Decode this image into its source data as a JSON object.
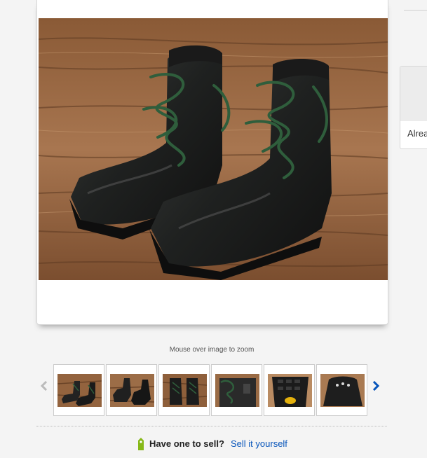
{
  "gallery": {
    "main_image": "ski-boots-pair-photo",
    "zoom_hint": "Mouse over image to zoom",
    "thumbnails": [
      {
        "subject": "boots-pair-wood"
      },
      {
        "subject": "boots-pair-side"
      },
      {
        "subject": "boots-top-view"
      },
      {
        "subject": "boot-closeup-laces"
      },
      {
        "subject": "boot-sole-tread"
      },
      {
        "subject": "boot-toe-holes"
      }
    ],
    "prev_icon": "chevron-left-icon",
    "next_icon": "chevron-right-icon"
  },
  "side_panel": {
    "text": "Alrea"
  },
  "sell": {
    "question": "Have one to sell?",
    "link": "Sell it yourself",
    "icon": "price-tag-icon"
  },
  "colors": {
    "link_blue": "#0654ba",
    "tag_green": "#86b817",
    "arrow_blue": "#0654ba",
    "arrow_gray": "#bbbbbb"
  }
}
